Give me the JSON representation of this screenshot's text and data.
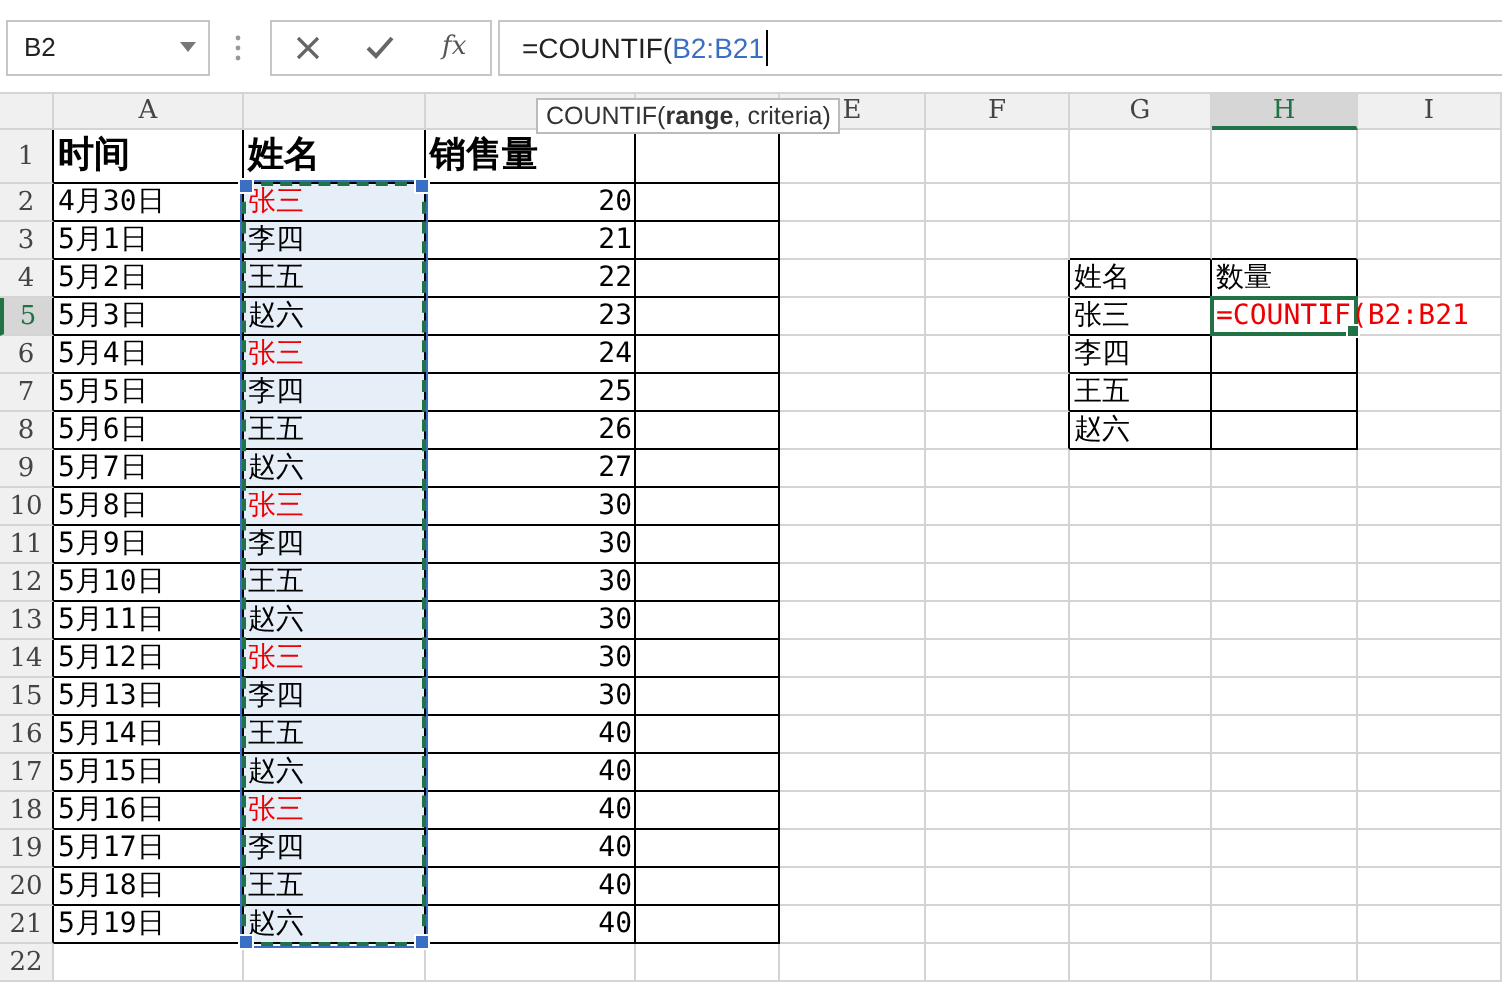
{
  "name_box": {
    "value": "B2"
  },
  "formula_bar": {
    "function_label": "fx",
    "formula": "=COUNTIF(",
    "range_ref": "B2:B21"
  },
  "tooltip": "COUNTIF(**range**, criteria)",
  "columns": [
    {
      "label": "A",
      "selected": false
    },
    {
      "selected": false
    },
    {
      "selected": false
    },
    {
      "selected": false
    },
    {
      "label": "E",
      "selected": false
    },
    {
      "label": "F",
      "selected": false
    },
    {
      "label": "G",
      "selected": false
    },
    {
      "label": "H",
      "selected": true
    },
    {
      "label": "I",
      "selected": false
    }
  ],
  "row_headers": [
    {
      "label": "1",
      "selected": false
    },
    {
      "label": "2",
      "selected": false
    },
    {
      "label": "3",
      "selected": false
    },
    {
      "label": "4",
      "selected": false
    },
    {
      "label": "5",
      "selected": true
    },
    {
      "label": "6",
      "selected": false
    },
    {
      "label": "7",
      "selected": false
    },
    {
      "label": "8",
      "selected": false
    },
    {
      "label": "9",
      "selected": false
    },
    {
      "label": "10",
      "selected": false
    },
    {
      "label": "11",
      "selected": false
    },
    {
      "label": "12",
      "selected": false
    },
    {
      "label": "13",
      "selected": false
    },
    {
      "label": "14",
      "selected": false
    },
    {
      "label": "15",
      "selected": false
    },
    {
      "label": "16",
      "selected": false
    },
    {
      "label": "17",
      "selected": false
    },
    {
      "label": "18",
      "selected": false
    },
    {
      "label": "19",
      "selected": false
    },
    {
      "label": "20",
      "selected": false
    },
    {
      "label": "21",
      "selected": false
    },
    {
      "label": "22",
      "selected": false
    }
  ],
  "main_table": {
    "header": [
      "时间",
      "姓名",
      "销售量"
    ],
    "rows": [
      {
        "date": "4月30日",
        "name": "张三",
        "highlighted": true,
        "name_selected": true,
        "sales": "20"
      },
      {
        "date": "5月1日",
        "name": "李四",
        "highlighted": false,
        "name_selected": true,
        "sales": "21"
      },
      {
        "date": "5月2日",
        "name": "王五",
        "highlighted": false,
        "name_selected": true,
        "sales": "22"
      },
      {
        "date": "5月3日",
        "name": "赵六",
        "highlighted": false,
        "name_selected": true,
        "sales": "23"
      },
      {
        "date": "5月4日",
        "name": "张三",
        "highlighted": true,
        "name_selected": true,
        "sales": "24"
      },
      {
        "date": "5月5日",
        "name": "李四",
        "highlighted": false,
        "name_selected": true,
        "sales": "25"
      },
      {
        "date": "5月6日",
        "name": "王五",
        "highlighted": false,
        "name_selected": true,
        "sales": "26"
      },
      {
        "date": "5月7日",
        "name": "赵六",
        "highlighted": false,
        "name_selected": true,
        "sales": "27"
      },
      {
        "date": "5月8日",
        "name": "张三",
        "highlighted": true,
        "name_selected": true,
        "sales": "30"
      },
      {
        "date": "5月9日",
        "name": "李四",
        "highlighted": false,
        "name_selected": true,
        "sales": "30"
      },
      {
        "date": "5月10日",
        "name": "王五",
        "highlighted": false,
        "name_selected": true,
        "sales": "30"
      },
      {
        "date": "5月11日",
        "name": "赵六",
        "highlighted": false,
        "name_selected": true,
        "sales": "30"
      },
      {
        "date": "5月12日",
        "name": "张三",
        "highlighted": true,
        "name_selected": true,
        "sales": "30"
      },
      {
        "date": "5月13日",
        "name": "李四",
        "highlighted": false,
        "name_selected": true,
        "sales": "30"
      },
      {
        "date": "5月14日",
        "name": "王五",
        "highlighted": false,
        "name_selected": true,
        "sales": "40"
      },
      {
        "date": "5月15日",
        "name": "赵六",
        "highlighted": false,
        "name_selected": true,
        "sales": "40"
      },
      {
        "date": "5月16日",
        "name": "张三",
        "highlighted": true,
        "name_selected": true,
        "sales": "40"
      },
      {
        "date": "5月17日",
        "name": "李四",
        "highlighted": false,
        "name_selected": true,
        "sales": "40"
      },
      {
        "date": "5月18日",
        "name": "王五",
        "highlighted": false,
        "name_selected": true,
        "sales": "40"
      },
      {
        "date": "5月19日",
        "name": "赵六",
        "highlighted": false,
        "name_selected": true,
        "sales": "40"
      }
    ]
  },
  "lookup_table": {
    "header": [
      "姓名",
      "数量"
    ],
    "rows": [
      {
        "name": "张三",
        "count": "=COUNTIF(B2:B21",
        "editing": true
      },
      {
        "name": "李四",
        "editing": false
      },
      {
        "name": "王五",
        "editing": false
      },
      {
        "name": "赵六",
        "editing": false
      }
    ]
  }
}
